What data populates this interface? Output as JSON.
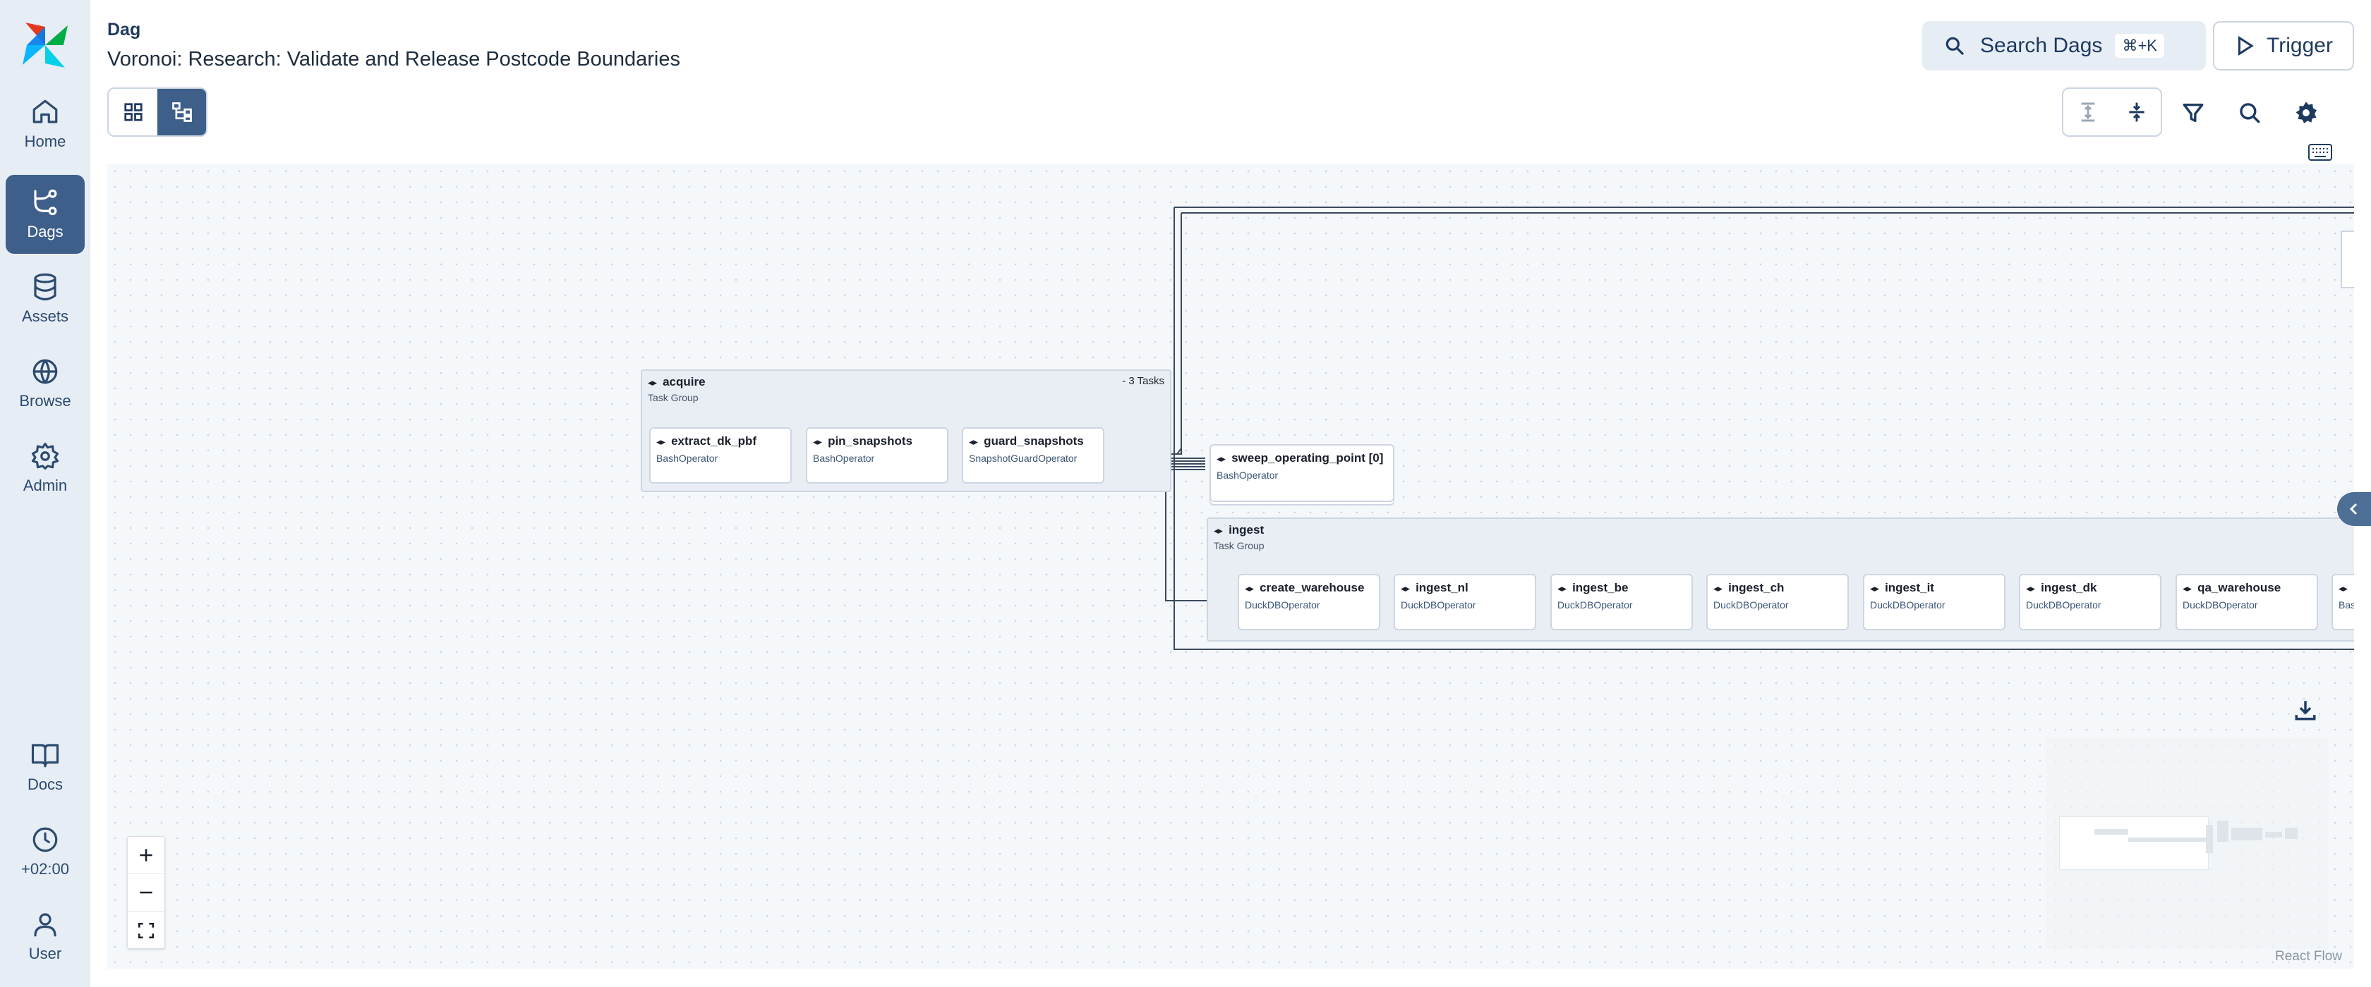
{
  "sidebar": {
    "items": [
      {
        "label": "Home",
        "icon": "home-icon"
      },
      {
        "label": "Dags",
        "icon": "dags-icon",
        "active": true
      },
      {
        "label": "Assets",
        "icon": "database-icon"
      },
      {
        "label": "Browse",
        "icon": "globe-icon"
      },
      {
        "label": "Admin",
        "icon": "gear-icon"
      },
      {
        "label": "Docs",
        "icon": "book-icon"
      },
      {
        "label": "+02:00",
        "icon": "clock-icon"
      },
      {
        "label": "User",
        "icon": "user-icon"
      }
    ]
  },
  "header": {
    "kind_label": "Dag",
    "dag_title": "Voronoi: Research: Validate and Release Postcode Boundaries",
    "search_label": "Search Dags",
    "search_shortcut": "⌘+K",
    "trigger_label": "Trigger"
  },
  "graph": {
    "groups": {
      "acquire": {
        "title": "acquire",
        "subtitle": "Task Group",
        "count": "- 3 Tasks"
      },
      "ingest": {
        "title": "ingest",
        "subtitle": "Task Group"
      }
    },
    "tasks": {
      "extract_dk_pbf": {
        "name": "extract_dk_pbf",
        "operator": "BashOperator"
      },
      "pin_snapshots": {
        "name": "pin_snapshots",
        "operator": "BashOperator"
      },
      "guard_snapshots": {
        "name": "guard_snapshots",
        "operator": "SnapshotGuardOperator"
      },
      "sweep_operating_point": {
        "name": "sweep_operating_point [0]",
        "operator": "BashOperator"
      },
      "create_warehouse": {
        "name": "create_warehouse",
        "operator": "DuckDBOperator"
      },
      "ingest_nl": {
        "name": "ingest_nl",
        "operator": "DuckDBOperator"
      },
      "ingest_be": {
        "name": "ingest_be",
        "operator": "DuckDBOperator"
      },
      "ingest_ch": {
        "name": "ingest_ch",
        "operator": "DuckDBOperator"
      },
      "ingest_it": {
        "name": "ingest_it",
        "operator": "DuckDBOperator"
      },
      "ingest_dk": {
        "name": "ingest_dk",
        "operator": "DuckDBOperator"
      },
      "qa_warehouse": {
        "name": "qa_warehouse",
        "operator": "DuckDBOperator"
      },
      "partial_task": {
        "name": "",
        "operator": "Bas"
      }
    }
  },
  "attribution": "React Flow",
  "colors": {
    "sidebar_bg": "#e6edf5",
    "accent": "#3d5f8a",
    "canvas_bg": "#f5f8fb"
  }
}
